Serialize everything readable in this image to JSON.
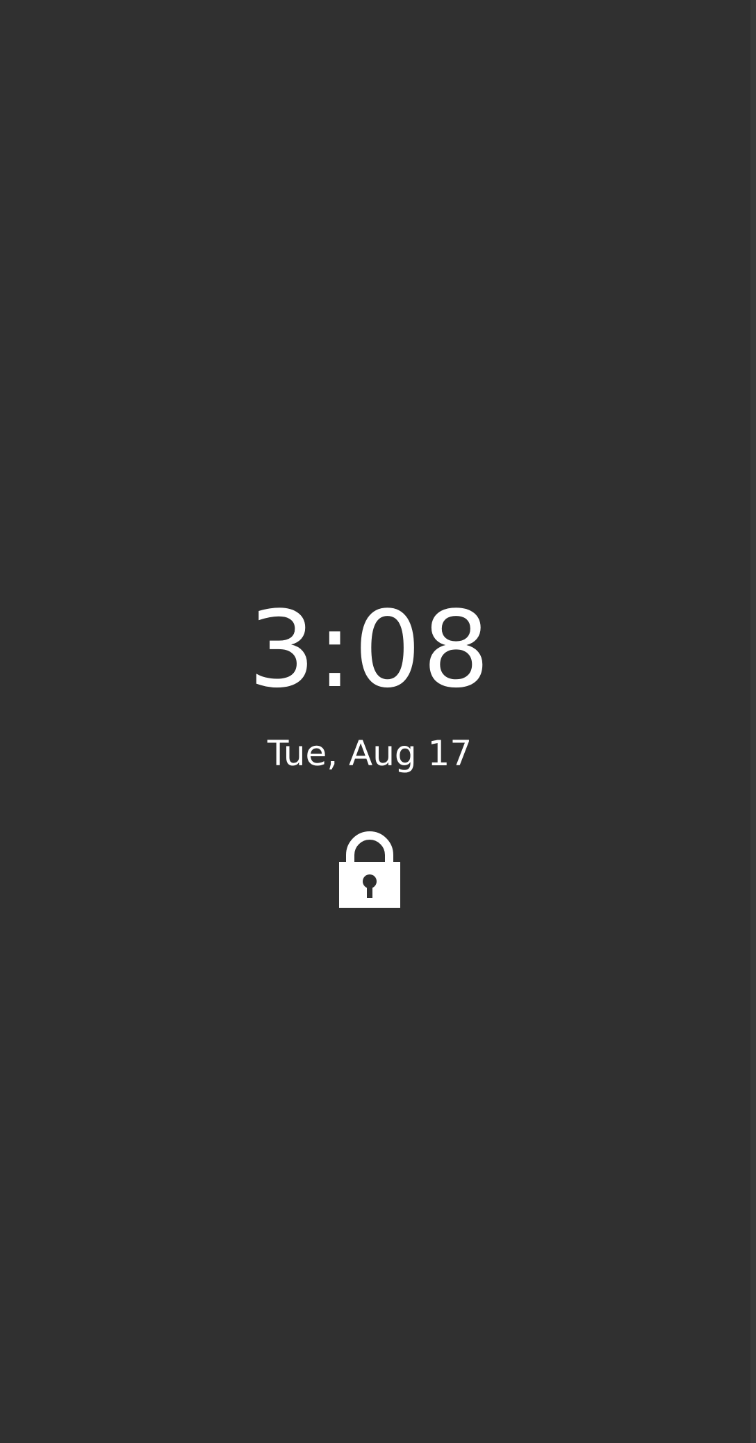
{
  "lockscreen": {
    "time": "3:08",
    "date": "Tue, Aug 17",
    "lock_icon": "lock-icon"
  },
  "colors": {
    "background": "#303030",
    "text": "#ffffff"
  }
}
